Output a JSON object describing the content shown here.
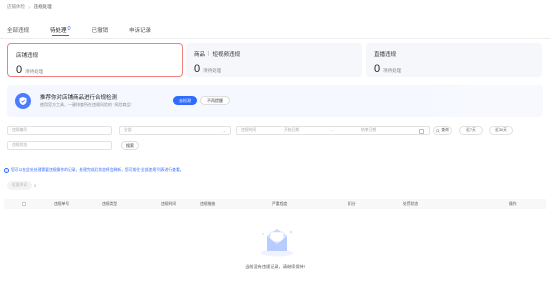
{
  "breadcrumb": {
    "items": [
      "店铺体检",
      "违规处理"
    ],
    "separator": ">"
  },
  "tabs": [
    {
      "label": "全部违规",
      "count": "",
      "active": false
    },
    {
      "label": "待处理",
      "count": "0",
      "active": true
    },
    {
      "label": "已撤销",
      "count": "",
      "active": false
    },
    {
      "label": "申诉记录",
      "count": "",
      "active": false
    }
  ],
  "stats": [
    {
      "title": "店铺违规",
      "title2": "",
      "value": "0",
      "unit": "项待处理",
      "active": true
    },
    {
      "title": "商品",
      "title2": "短视频违规",
      "value": "0",
      "unit": "项待处理",
      "active": false
    },
    {
      "title": "直播违规",
      "title2": "",
      "value": "0",
      "unit": "项待处理",
      "active": false
    }
  ],
  "promo": {
    "title": "推荐你对店铺商品进行合规检测",
    "subtitle": "使用官方工具，一键排查所在违规风险的 “风险商品”",
    "primary_label": "去检测",
    "secondary_label": "不再提醒"
  },
  "filters": {
    "violation_id_placeholder": "违规编号",
    "type_placeholder": "全部",
    "date_label": "违规时间",
    "date_start_placeholder": "开始日期",
    "date_tilde": "~",
    "date_end_placeholder": "结束日期",
    "btn_query": "查询",
    "btn_recent7": "近7天",
    "btn_recent30": "近30天",
    "status_placeholder": "违规状态",
    "search_label": "搜索"
  },
  "notice": "您可以在此处处理需要违规操作的记录，处理完成后状态将会刷新，您可前往‘全部违规’列表进行查看。",
  "batch": {
    "button_label": "批量申诉",
    "count": "0"
  },
  "table": {
    "headers": [
      "违规单号",
      "违规类型",
      "违规时间",
      "违规措施",
      "严重程度",
      "扣分",
      "处罚状态",
      "操作"
    ]
  },
  "empty": {
    "text": "当前没有违规记录，请继续保持!"
  },
  "colors": {
    "accent": "#2f6bff",
    "active_border": "#f08080"
  }
}
